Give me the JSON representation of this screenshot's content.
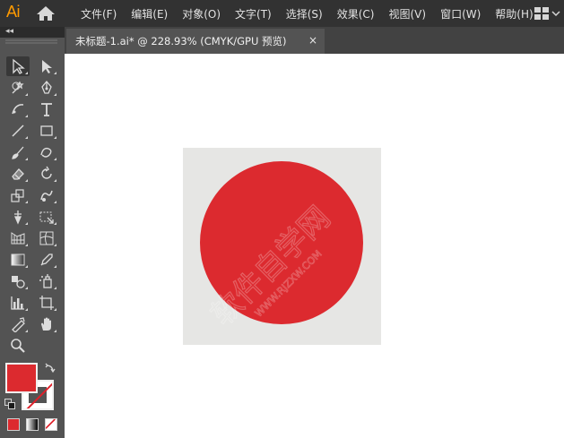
{
  "app": {
    "logo": "Ai",
    "accent_color": "#ff9a00"
  },
  "menu": {
    "items": [
      "文件(F)",
      "编辑(E)",
      "对象(O)",
      "文字(T)",
      "选择(S)",
      "效果(C)",
      "视图(V)",
      "窗口(W)",
      "帮助(H)"
    ]
  },
  "toolbar": {
    "collapse_label": "◂◂",
    "tools": [
      {
        "name": "selection-tool-icon",
        "interactable": true
      },
      {
        "name": "direct-selection-tool-icon",
        "interactable": true
      },
      {
        "name": "magic-wand-tool-icon",
        "interactable": true
      },
      {
        "name": "pen-tool-icon",
        "interactable": true
      },
      {
        "name": "curvature-tool-icon",
        "interactable": true
      },
      {
        "name": "type-tool-icon",
        "interactable": true
      },
      {
        "name": "line-segment-tool-icon",
        "interactable": true
      },
      {
        "name": "rectangle-tool-icon",
        "interactable": true
      },
      {
        "name": "paintbrush-tool-icon",
        "interactable": true
      },
      {
        "name": "shaper-tool-icon",
        "interactable": true
      },
      {
        "name": "eraser-tool-icon",
        "interactable": true
      },
      {
        "name": "rotate-tool-icon",
        "interactable": true
      },
      {
        "name": "scale-tool-icon",
        "interactable": true
      },
      {
        "name": "warp-tool-icon",
        "interactable": true
      },
      {
        "name": "puppet-warp-tool-icon",
        "interactable": true
      },
      {
        "name": "free-transform-tool-icon",
        "interactable": true
      },
      {
        "name": "perspective-grid-tool-icon",
        "interactable": true
      },
      {
        "name": "mesh-tool-icon",
        "interactable": true
      },
      {
        "name": "gradient-tool-icon",
        "interactable": true
      },
      {
        "name": "eyedropper-tool-icon",
        "interactable": true
      },
      {
        "name": "blend-tool-icon",
        "interactable": true
      },
      {
        "name": "symbol-sprayer-tool-icon",
        "interactable": true
      },
      {
        "name": "column-graph-tool-icon",
        "interactable": true
      },
      {
        "name": "artboard-tool-icon",
        "interactable": true
      },
      {
        "name": "slice-tool-icon",
        "interactable": true
      },
      {
        "name": "hand-tool-icon",
        "interactable": true
      },
      {
        "name": "zoom-tool-icon",
        "interactable": true
      }
    ],
    "fill_color": "#dc2a2f",
    "stroke": "none"
  },
  "document": {
    "tab_title": "未标题-1.ai* @ 228.93% (CMYK/GPU 预览)",
    "close_label": "×"
  },
  "artwork": {
    "artboard_color": "#e6e6e4",
    "circle_color": "#dc2a2f",
    "watermark": "软件自学网",
    "watermark_url": "WWW.RJZXW.COM"
  }
}
